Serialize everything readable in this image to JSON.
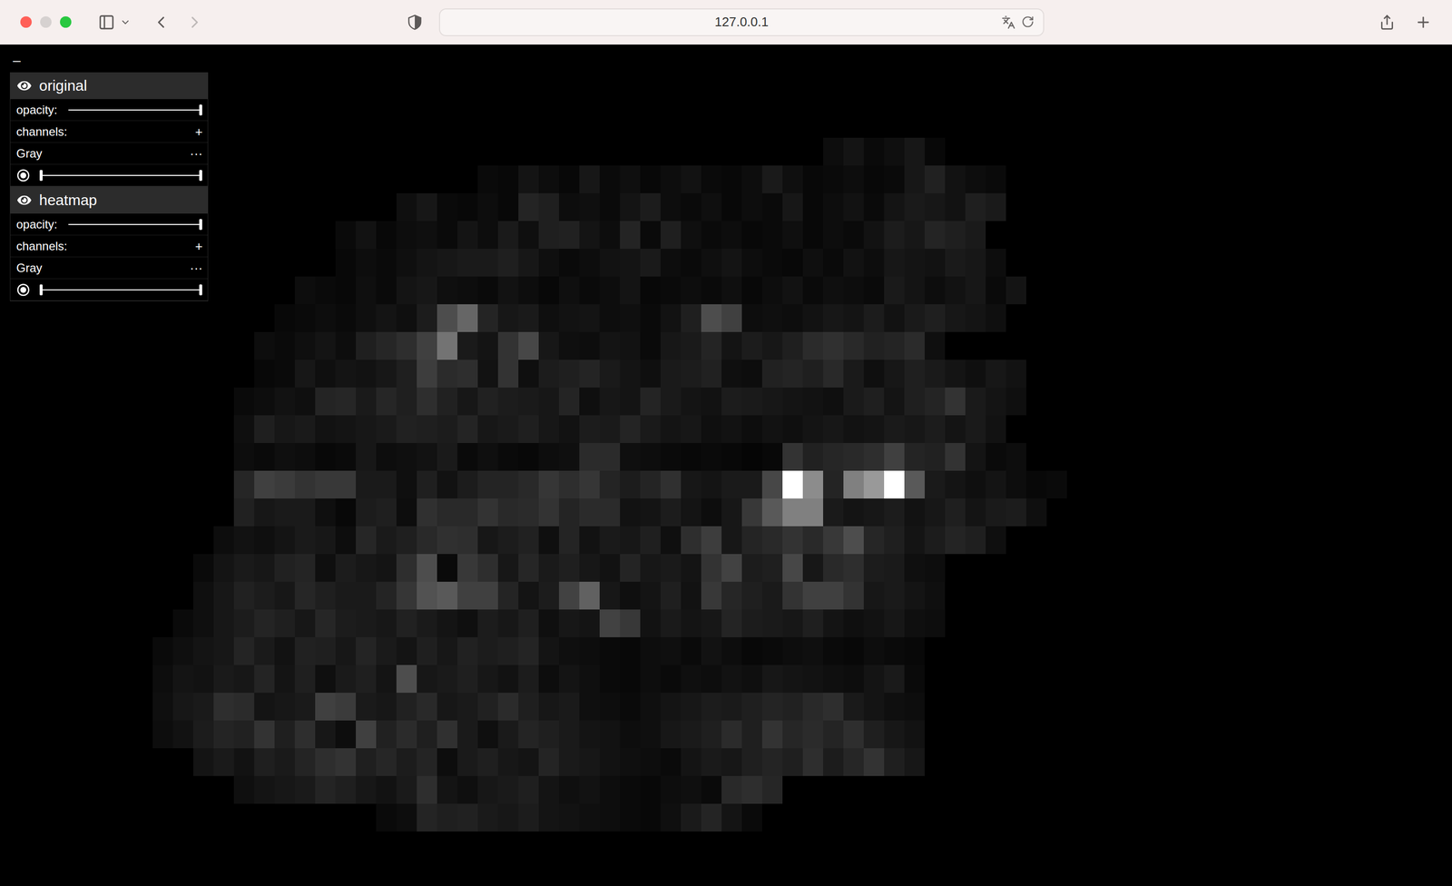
{
  "browser": {
    "address": "127.0.0.1",
    "back_enabled": true,
    "forward_enabled": false
  },
  "panel": {
    "collapse": "–",
    "layers": [
      {
        "name": "original",
        "visible": true,
        "opacity_label": "opacity:",
        "opacity": 1,
        "channels_label": "channels:",
        "add": "+",
        "channel": {
          "name": "Gray",
          "menu": "···",
          "selected": true,
          "range": {
            "low": 0,
            "high": 1
          }
        }
      },
      {
        "name": "heatmap",
        "visible": true,
        "opacity_label": "opacity:",
        "opacity": 1,
        "channels_label": "channels:",
        "add": "+",
        "channel": {
          "name": "Gray",
          "menu": "···",
          "selected": true,
          "range": {
            "low": 0,
            "high": 1
          }
        }
      }
    ]
  },
  "image": {
    "values": [
      [
        0,
        0,
        0,
        0,
        0,
        0,
        0,
        0,
        0,
        0,
        0,
        0,
        0,
        0,
        0,
        0,
        0,
        0,
        0,
        0,
        0,
        0,
        0,
        0,
        0,
        0,
        0,
        0,
        0,
        0,
        0,
        0,
        0,
        5,
        8,
        4,
        6,
        9,
        3,
        0,
        0,
        0,
        0,
        0,
        0
      ],
      [
        0,
        0,
        0,
        0,
        0,
        0,
        0,
        0,
        0,
        0,
        0,
        0,
        0,
        0,
        0,
        0,
        4,
        3,
        8,
        5,
        3,
        9,
        4,
        6,
        3,
        5,
        7,
        4,
        3,
        5,
        10,
        6,
        3,
        4,
        5,
        3,
        4,
        9,
        13,
        7,
        5,
        4,
        0,
        0,
        0
      ],
      [
        0,
        0,
        0,
        0,
        0,
        0,
        0,
        0,
        0,
        0,
        0,
        0,
        6,
        9,
        4,
        3,
        5,
        3,
        14,
        12,
        5,
        6,
        4,
        8,
        11,
        5,
        4,
        6,
        3,
        5,
        4,
        9,
        3,
        5,
        7,
        4,
        8,
        10,
        9,
        7,
        12,
        10,
        0,
        0,
        0
      ],
      [
        0,
        0,
        0,
        0,
        0,
        0,
        0,
        0,
        0,
        4,
        7,
        3,
        5,
        6,
        4,
        8,
        5,
        10,
        6,
        12,
        13,
        8,
        5,
        14,
        4,
        12,
        6,
        4,
        5,
        3,
        4,
        6,
        3,
        5,
        4,
        7,
        11,
        9,
        14,
        12,
        10,
        0,
        0,
        0,
        0
      ],
      [
        0,
        0,
        0,
        0,
        0,
        0,
        0,
        0,
        0,
        3,
        5,
        4,
        6,
        8,
        9,
        10,
        10,
        12,
        9,
        6,
        4,
        5,
        7,
        8,
        10,
        5,
        4,
        6,
        8,
        5,
        4,
        3,
        6,
        4,
        7,
        5,
        9,
        8,
        7,
        10,
        9,
        5,
        0,
        0,
        0
      ],
      [
        0,
        0,
        0,
        0,
        0,
        0,
        0,
        5,
        4,
        3,
        6,
        4,
        8,
        9,
        6,
        5,
        4,
        7,
        5,
        3,
        6,
        4,
        5,
        8,
        3,
        4,
        5,
        4,
        6,
        3,
        5,
        7,
        4,
        6,
        5,
        4,
        10,
        8,
        5,
        7,
        9,
        4,
        8,
        0,
        0
      ],
      [
        0,
        0,
        0,
        0,
        0,
        0,
        3,
        4,
        5,
        4,
        6,
        8,
        6,
        11,
        30,
        40,
        14,
        9,
        10,
        6,
        7,
        8,
        5,
        6,
        4,
        7,
        12,
        30,
        25,
        5,
        6,
        5,
        7,
        9,
        8,
        11,
        7,
        10,
        12,
        9,
        8,
        6,
        0,
        0,
        0
      ],
      [
        0,
        0,
        0,
        0,
        0,
        5,
        4,
        6,
        8,
        5,
        12,
        15,
        18,
        25,
        45,
        10,
        8,
        20,
        28,
        9,
        6,
        5,
        8,
        7,
        4,
        9,
        10,
        14,
        8,
        11,
        9,
        12,
        17,
        19,
        16,
        13,
        14,
        17,
        6,
        0,
        0,
        0,
        0,
        0,
        0
      ],
      [
        0,
        0,
        0,
        0,
        0,
        3,
        4,
        9,
        6,
        8,
        7,
        9,
        12,
        24,
        17,
        18,
        7,
        20,
        6,
        11,
        12,
        14,
        10,
        8,
        6,
        10,
        11,
        13,
        6,
        5,
        13,
        14,
        12,
        16,
        10,
        6,
        9,
        12,
        10,
        8,
        6,
        9,
        7,
        0,
        0
      ],
      [
        0,
        0,
        0,
        0,
        4,
        5,
        7,
        6,
        14,
        15,
        10,
        15,
        12,
        18,
        13,
        9,
        13,
        11,
        10,
        9,
        14,
        6,
        9,
        8,
        14,
        10,
        8,
        7,
        11,
        10,
        9,
        8,
        7,
        6,
        10,
        12,
        8,
        12,
        14,
        20,
        10,
        8,
        6,
        0,
        0
      ],
      [
        0,
        0,
        0,
        0,
        6,
        12,
        9,
        10,
        7,
        8,
        9,
        10,
        13,
        12,
        11,
        14,
        9,
        10,
        12,
        9,
        7,
        11,
        10,
        14,
        10,
        8,
        9,
        6,
        7,
        5,
        7,
        6,
        8,
        9,
        7,
        8,
        10,
        9,
        11,
        8,
        10,
        7,
        0,
        0,
        0
      ],
      [
        0,
        0,
        0,
        0,
        5,
        4,
        6,
        5,
        3,
        4,
        9,
        5,
        6,
        7,
        10,
        4,
        6,
        4,
        3,
        5,
        6,
        17,
        17,
        6,
        5,
        4,
        3,
        4,
        3,
        2,
        3,
        20,
        13,
        15,
        16,
        18,
        25,
        14,
        13,
        20,
        8,
        4,
        5,
        0,
        0
      ],
      [
        0,
        0,
        0,
        0,
        15,
        25,
        23,
        20,
        22,
        22,
        10,
        10,
        6,
        12,
        7,
        11,
        14,
        14,
        16,
        21,
        18,
        21,
        14,
        11,
        14,
        19,
        9,
        8,
        10,
        10,
        28,
        100,
        55,
        14,
        50,
        60,
        100,
        35,
        10,
        8,
        6,
        8,
        5,
        3,
        4
      ],
      [
        0,
        0,
        0,
        0,
        13,
        9,
        10,
        10,
        6,
        3,
        11,
        12,
        5,
        19,
        16,
        16,
        20,
        16,
        17,
        20,
        14,
        17,
        17,
        7,
        8,
        11,
        8,
        5,
        9,
        22,
        35,
        50,
        50,
        10,
        8,
        9,
        11,
        7,
        9,
        12,
        8,
        10,
        11,
        6,
        0
      ],
      [
        0,
        0,
        0,
        5,
        7,
        6,
        8,
        10,
        9,
        5,
        15,
        10,
        12,
        16,
        19,
        18,
        9,
        11,
        13,
        6,
        14,
        7,
        10,
        9,
        12,
        6,
        18,
        24,
        9,
        14,
        16,
        20,
        16,
        22,
        30,
        15,
        12,
        8,
        11,
        14,
        12,
        6,
        0,
        0,
        0
      ],
      [
        0,
        0,
        4,
        8,
        10,
        9,
        13,
        14,
        6,
        11,
        9,
        8,
        18,
        30,
        4,
        22,
        18,
        9,
        15,
        10,
        12,
        9,
        7,
        14,
        9,
        10,
        8,
        20,
        26,
        11,
        12,
        28,
        9,
        16,
        18,
        11,
        10,
        6,
        5,
        0,
        0,
        0,
        0,
        0,
        0
      ],
      [
        0,
        0,
        6,
        9,
        13,
        11,
        9,
        15,
        12,
        10,
        10,
        14,
        21,
        32,
        35,
        25,
        25,
        14,
        8,
        11,
        26,
        38,
        9,
        6,
        8,
        12,
        7,
        22,
        15,
        12,
        10,
        20,
        25,
        25,
        20,
        9,
        10,
        8,
        6,
        0,
        0,
        0,
        0,
        0,
        0
      ],
      [
        0,
        4,
        6,
        9,
        11,
        14,
        12,
        9,
        15,
        11,
        10,
        9,
        13,
        10,
        8,
        6,
        11,
        9,
        12,
        6,
        9,
        8,
        26,
        22,
        7,
        10,
        8,
        9,
        14,
        11,
        10,
        9,
        12,
        8,
        6,
        7,
        9,
        6,
        5,
        0,
        0,
        0,
        0,
        0,
        0
      ],
      [
        4,
        6,
        8,
        9,
        14,
        10,
        7,
        13,
        12,
        9,
        14,
        10,
        8,
        12,
        9,
        13,
        11,
        12,
        14,
        8,
        6,
        5,
        4,
        3,
        5,
        6,
        4,
        7,
        5,
        3,
        4,
        5,
        6,
        4,
        3,
        5,
        4,
        3,
        0,
        0,
        0,
        0,
        0,
        0,
        0
      ],
      [
        5,
        8,
        7,
        10,
        9,
        14,
        8,
        12,
        6,
        10,
        12,
        8,
        30,
        9,
        10,
        12,
        9,
        7,
        11,
        5,
        8,
        6,
        4,
        3,
        5,
        4,
        6,
        5,
        7,
        6,
        9,
        8,
        7,
        6,
        5,
        8,
        10,
        4,
        0,
        0,
        0,
        0,
        0,
        0,
        0
      ],
      [
        6,
        9,
        10,
        18,
        17,
        8,
        9,
        10,
        25,
        23,
        10,
        9,
        13,
        16,
        9,
        10,
        13,
        17,
        12,
        9,
        10,
        6,
        5,
        4,
        6,
        8,
        9,
        11,
        10,
        12,
        14,
        13,
        16,
        18,
        10,
        8,
        6,
        5,
        0,
        0,
        0,
        0,
        0,
        0,
        0
      ],
      [
        5,
        7,
        11,
        14,
        13,
        20,
        12,
        18,
        9,
        5,
        25,
        13,
        17,
        12,
        19,
        10,
        6,
        10,
        14,
        12,
        10,
        8,
        7,
        5,
        6,
        9,
        10,
        12,
        17,
        12,
        20,
        15,
        17,
        14,
        18,
        12,
        9,
        7,
        0,
        0,
        0,
        0,
        0,
        0,
        0
      ],
      [
        0,
        0,
        8,
        10,
        7,
        12,
        10,
        14,
        18,
        20,
        12,
        15,
        11,
        14,
        5,
        10,
        12,
        9,
        8,
        14,
        10,
        9,
        7,
        6,
        5,
        4,
        8,
        10,
        9,
        12,
        14,
        12,
        18,
        11,
        15,
        20,
        12,
        9,
        0,
        0,
        0,
        0,
        0,
        0,
        0
      ],
      [
        0,
        0,
        0,
        0,
        6,
        8,
        9,
        10,
        14,
        12,
        9,
        7,
        10,
        18,
        8,
        6,
        9,
        10,
        12,
        8,
        6,
        7,
        5,
        4,
        3,
        5,
        6,
        4,
        16,
        18,
        15,
        0,
        0,
        0,
        0,
        0,
        0,
        0,
        0,
        0,
        0,
        0,
        0,
        0,
        0
      ],
      [
        0,
        0,
        0,
        0,
        0,
        0,
        0,
        0,
        0,
        0,
        0,
        4,
        5,
        14,
        12,
        13,
        10,
        9,
        11,
        8,
        7,
        6,
        5,
        4,
        3,
        6,
        10,
        14,
        8,
        4,
        0,
        0,
        0,
        0,
        0,
        0,
        0,
        0,
        0,
        0,
        0,
        0,
        0,
        0,
        0
      ]
    ]
  }
}
